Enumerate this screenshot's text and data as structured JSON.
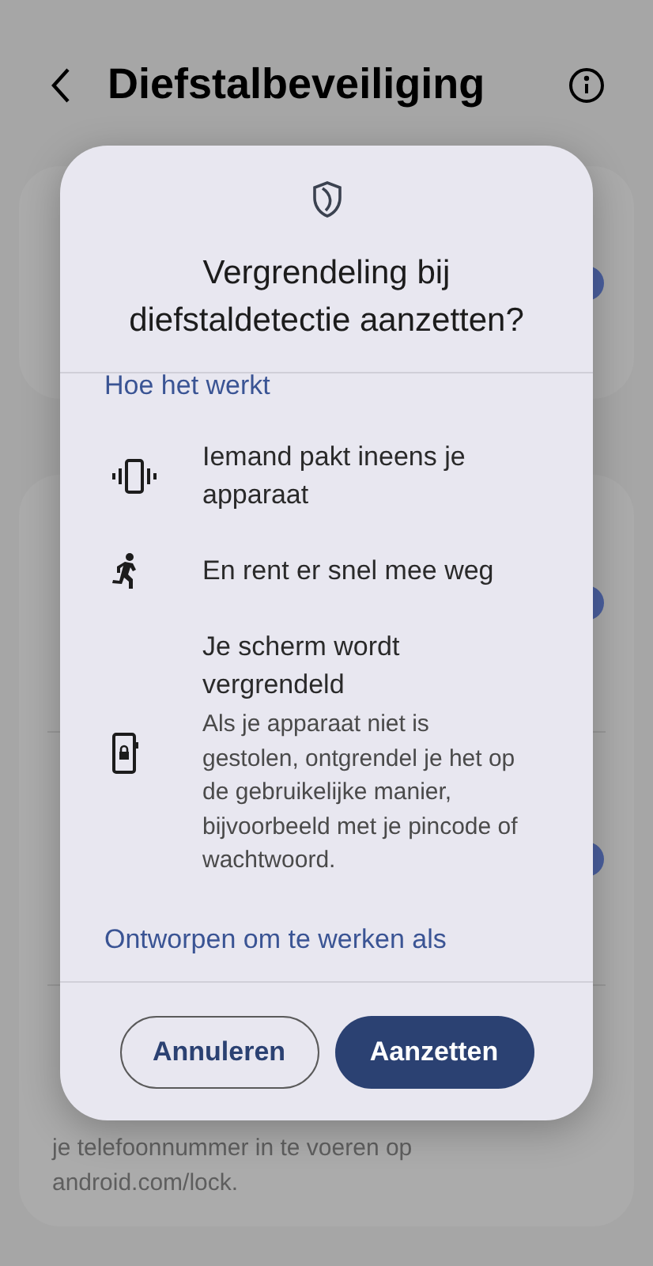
{
  "header": {
    "title": "Diefstalbeveiliging"
  },
  "background_cards": [
    {
      "items": [
        {
          "toggle": {
            "on": true
          }
        }
      ]
    },
    {
      "items": [
        {
          "toggle": {
            "on": true
          }
        },
        {
          "toggle": {
            "on": true
          }
        },
        {
          "lines": [
            "je telefoonnummer in te voeren op",
            "android.com/lock."
          ]
        }
      ]
    }
  ],
  "dialog": {
    "title": "Vergrendeling bij diefstaldetectie aanzetten?",
    "link": "Hoe het werkt",
    "steps": [
      {
        "kind": "vibrating-phone",
        "title": "Iemand pakt ineens je apparaat"
      },
      {
        "kind": "running-person",
        "title": "En rent er snel mee weg"
      },
      {
        "kind": "locked-phone",
        "title": "Je scherm wordt vergrendeld",
        "description": "Als je apparaat niet is gestolen, ontgrendel je het op de gebruikelijke manier, bijvoorbeeld met je pincode of wachtwoord."
      }
    ],
    "footer_link": "Ontworpen om te werken als",
    "buttons": [
      {
        "label": "Annuleren",
        "kind": "outlined"
      },
      {
        "label": "Aanzetten",
        "kind": "filled"
      }
    ]
  }
}
